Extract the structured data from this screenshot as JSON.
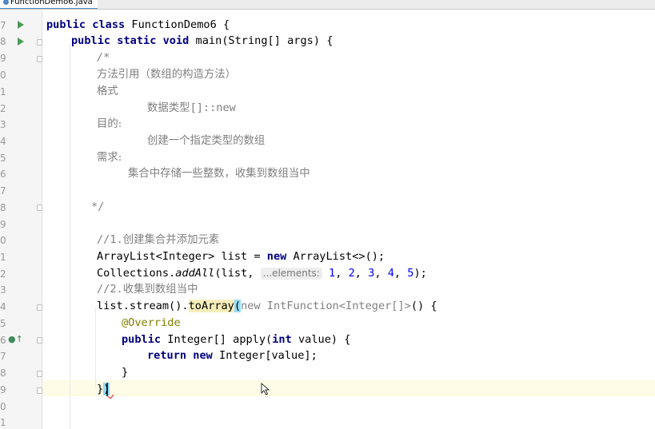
{
  "tab": {
    "filename": "FunctionDemo6.java"
  },
  "gutter": {
    "line_numbers": [
      "7",
      "8",
      "9",
      "0",
      "1",
      "2",
      "3",
      "4",
      "5",
      "6",
      "7",
      "8",
      "9",
      "0",
      "1",
      "2",
      "3",
      "4",
      "5",
      "6",
      "7",
      "8",
      "9",
      "0",
      "1"
    ]
  },
  "code": {
    "l1": {
      "kw": "public class",
      "rest": " FunctionDemo6 {"
    },
    "l2": {
      "kw1": "public static void",
      "rest": " main(String[] args) {"
    },
    "l3": "/*",
    "l4": "方法引用（数组的构造方法）",
    "l5": "格式",
    "l6_a": "数据类型",
    "l6_b": "[]::new",
    "l7": "目的:",
    "l8": "创建一个指定类型的数组",
    "l9": "需求:",
    "l10": "集合中存储一些整数，收集到数组当中",
    "l11": "*/",
    "l12_a": "//1.",
    "l12_b": "创建集合并添加元素",
    "l13_a": "ArrayList<Integer> list = ",
    "l13_kw": "new",
    "l13_b": " ArrayList<>();",
    "l14_a": "Collections.",
    "l14_m": "addAll",
    "l14_b": "(list, ",
    "l14_hint": "...elements:",
    "l14_nums": [
      "1",
      "2",
      "3",
      "4",
      "5"
    ],
    "l14_end": ");",
    "l15_a": "//2.",
    "l15_b": "收集到数组当中",
    "l16_a": "list.stream().",
    "l16_m": "toArray",
    "l16_p": "(",
    "l16_dim1": "new",
    "l16_dim2": " IntFunction<Integer[]>",
    "l16_b": "() {",
    "l17": "@Override",
    "l18_kw": "public",
    "l18_a": " Integer[] apply(",
    "l18_kw2": "int",
    "l18_b": " value) {",
    "l19_kw": "return new",
    "l19_b": " Integer[value];",
    "l20": "}",
    "l21_a": "}",
    "l21_p": ")"
  }
}
